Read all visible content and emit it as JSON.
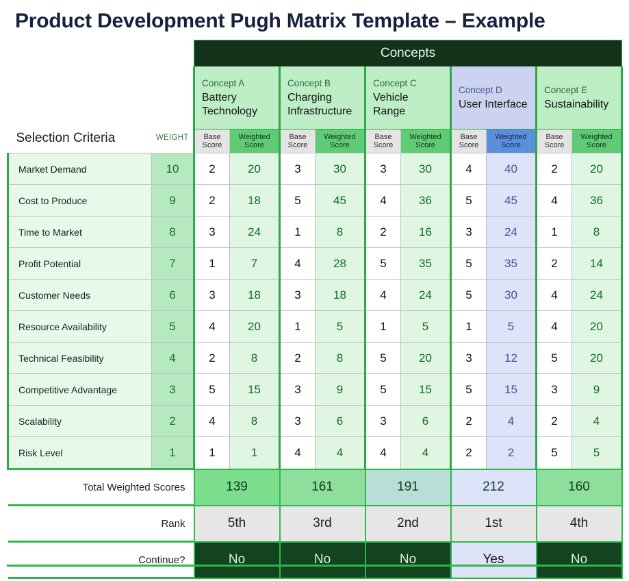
{
  "page_title": "Product Development Pugh Matrix Template – Example",
  "header": {
    "concepts_banner": "Concepts",
    "selection_criteria_label": "Selection Criteria",
    "weight_label": "WEIGHT",
    "base_score_label": "Base\nScore",
    "base_score_line1": "Base",
    "base_score_line2": "Score",
    "weighted_score_line1": "Weighted",
    "weighted_score_line2": "Score"
  },
  "concepts": [
    {
      "id": "Concept A",
      "name": "Battery Technology",
      "highlight": false
    },
    {
      "id": "Concept B",
      "name": "Charging Infrastructure",
      "highlight": false
    },
    {
      "id": "Concept C",
      "name": "Vehicle Range",
      "highlight": false
    },
    {
      "id": "Concept D",
      "name": "User Interface",
      "highlight": true
    },
    {
      "id": "Concept E",
      "name": "Sustainability",
      "highlight": false
    }
  ],
  "criteria": [
    {
      "name": "Market Demand",
      "weight": 10,
      "base": [
        2,
        3,
        3,
        4,
        2
      ],
      "weighted": [
        20,
        30,
        30,
        40,
        20
      ]
    },
    {
      "name": "Cost to Produce",
      "weight": 9,
      "base": [
        2,
        5,
        4,
        5,
        4
      ],
      "weighted": [
        18,
        45,
        36,
        45,
        36
      ]
    },
    {
      "name": "Time to Market",
      "weight": 8,
      "base": [
        3,
        1,
        2,
        3,
        1
      ],
      "weighted": [
        24,
        8,
        16,
        24,
        8
      ]
    },
    {
      "name": "Profit Potential",
      "weight": 7,
      "base": [
        1,
        4,
        5,
        5,
        2
      ],
      "weighted": [
        7,
        28,
        35,
        35,
        14
      ]
    },
    {
      "name": "Customer Needs",
      "weight": 6,
      "base": [
        3,
        3,
        4,
        5,
        4
      ],
      "weighted": [
        18,
        18,
        24,
        30,
        24
      ]
    },
    {
      "name": "Resource Availability",
      "weight": 5,
      "base": [
        4,
        1,
        1,
        1,
        4
      ],
      "weighted": [
        20,
        5,
        5,
        5,
        20
      ]
    },
    {
      "name": "Technical Feasibility",
      "weight": 4,
      "base": [
        2,
        2,
        5,
        3,
        5
      ],
      "weighted": [
        8,
        8,
        20,
        12,
        20
      ]
    },
    {
      "name": "Competitive Advantage",
      "weight": 3,
      "base": [
        5,
        3,
        5,
        5,
        3
      ],
      "weighted": [
        15,
        9,
        15,
        15,
        9
      ]
    },
    {
      "name": "Scalability",
      "weight": 2,
      "base": [
        4,
        3,
        3,
        2,
        2
      ],
      "weighted": [
        8,
        6,
        6,
        4,
        4
      ]
    },
    {
      "name": "Risk Level",
      "weight": 1,
      "base": [
        1,
        4,
        4,
        2,
        5
      ],
      "weighted": [
        1,
        4,
        4,
        2,
        5
      ]
    }
  ],
  "summary": {
    "total_label": "Total Weighted Scores",
    "totals": [
      139,
      161,
      191,
      212,
      160
    ],
    "rank_label": "Rank",
    "ranks": [
      "5th",
      "3rd",
      "2nd",
      "1st",
      "4th"
    ],
    "continue_label": "Continue?",
    "continues": [
      "No",
      "No",
      "No",
      "Yes",
      "No"
    ]
  },
  "colors": {
    "title": "#16213E",
    "banner_bg": "#14311A",
    "accent_green": "#2EB84C",
    "concept_header_green": "#BDEEC5",
    "concept_header_blue": "#CBD3F0",
    "weighted_header_green": "#5FCB75",
    "weighted_header_blue": "#5B8FDA",
    "base_header_gray": "#E4E4E4",
    "criteria_row_bg": "#E6F9EA",
    "weight_col_bg": "#B6E9C0",
    "weighted_cell_green": "#DEF6E2",
    "weighted_cell_blue": "#DDE3F9",
    "total_green": "#7CDD8C",
    "total_teal": "#B7DFD6",
    "total_blue": "#DDE3F9",
    "rank_gray": "#E6E6E6",
    "continue_dark": "#14441F",
    "continue_yes": "#DDE3F9"
  }
}
